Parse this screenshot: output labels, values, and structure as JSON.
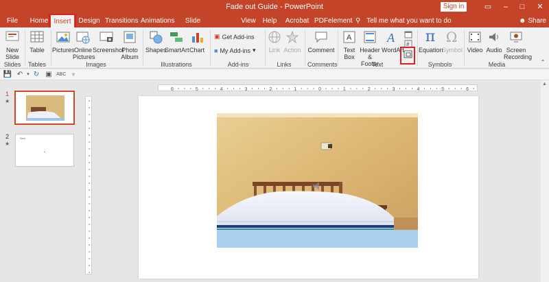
{
  "window": {
    "title": "Fade out Guide  -  PowerPoint",
    "signin": "Sign in",
    "controls": [
      "–",
      "□",
      "✕",
      "▭"
    ]
  },
  "tabs": [
    "File",
    "Home",
    "Insert",
    "Design",
    "Transitions",
    "Animations",
    "Slide Show",
    "View",
    "Help",
    "Acrobat",
    "PDFelement"
  ],
  "active_tab": "Insert",
  "tell_me": "Tell me what you want to do",
  "share": "Share",
  "ribbon": {
    "slides": {
      "new_slide": "New\nSlide",
      "group": "Slides"
    },
    "tables": {
      "table": "Table",
      "group": "Tables"
    },
    "images": {
      "pictures": "Pictures",
      "online_pictures": "Online\nPictures",
      "screenshot": "Screenshot",
      "photo_album": "Photo\nAlbum",
      "group": "Images"
    },
    "illustrations": {
      "shapes": "Shapes",
      "smartart": "SmartArt",
      "chart": "Chart",
      "group": "Illustrations"
    },
    "addins": {
      "get_addins": "Get Add-ins",
      "my_addins": "My Add-ins",
      "group": "Add-ins"
    },
    "links": {
      "link": "Link",
      "action": "Action",
      "group": "Links"
    },
    "comments": {
      "comment": "Comment",
      "group": "Comments"
    },
    "text": {
      "text_box": "Text\nBox",
      "header_footer": "Header\n& Footer",
      "wordart": "WordArt",
      "group": "Text"
    },
    "symbols": {
      "equation": "Equation",
      "symbol": "Symbol",
      "group": "Symbols"
    },
    "media": {
      "video": "Video",
      "audio": "Audio",
      "screen_recording": "Screen\nRecording",
      "group": "Media"
    }
  },
  "thumbnails": [
    {
      "number": "1",
      "selected": true
    },
    {
      "number": "2",
      "selected": false,
      "text": "Next"
    }
  ],
  "ruler_labels": [
    "6",
    "5",
    "4",
    "3",
    "2",
    "1",
    "0",
    "1",
    "2",
    "3",
    "4",
    "5",
    "6"
  ],
  "colors": {
    "accent": "#c4442a",
    "highlight": "#e02020"
  }
}
